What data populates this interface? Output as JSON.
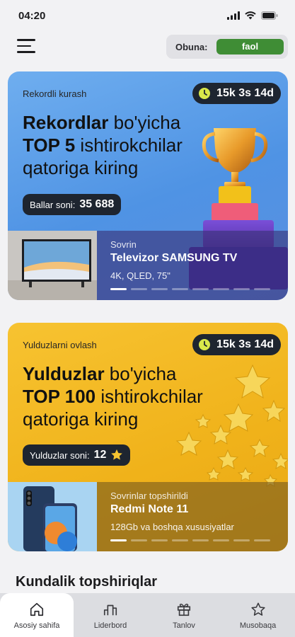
{
  "status_bar": {
    "time": "04:20"
  },
  "header": {
    "subscription_label": "Obuna:",
    "subscription_status": "faol"
  },
  "cards": [
    {
      "tag": "Rekordli kurash",
      "timer": "15k 3s 14d",
      "title_bold_1": "Rekordlar",
      "title_rest_1": " bo'yicha",
      "title_bold_2": "TOP 5",
      "title_rest_2": " ishtirokchilar",
      "title_line_3": "qatoriga kiring",
      "score_label": "Ballar soni:",
      "score_value": "35 688",
      "prize_kicker": "Sovrin",
      "prize_name": "Televizor SAMSUNG TV",
      "prize_spec": "4K, QLED, 75\"",
      "slides_total": 8,
      "slide_active": 1
    },
    {
      "tag": "Yulduzlarni ovlash",
      "timer": "15k 3s 14d",
      "title_bold_1": "Yulduzlar",
      "title_rest_1": " bo'yicha",
      "title_bold_2": "TOP 100",
      "title_rest_2": " ishtirokchilar",
      "title_line_3": "qatoriga kiring",
      "score_label": "Yulduzlar soni:",
      "score_value": "12",
      "prize_kicker": "Sovrinlar topshirildi",
      "prize_name": "Redmi Note 11",
      "prize_spec": "128Gb va boshqa xususiyatlar",
      "slides_total": 8,
      "slide_active": 1
    }
  ],
  "daily_tasks_title": "Kundalik topshiriqlar",
  "tabs": [
    {
      "label": "Asosiy sahifa",
      "icon": "home-icon",
      "active": true
    },
    {
      "label": "Liderbord",
      "icon": "leaderboard-icon",
      "active": false
    },
    {
      "label": "Tanlov",
      "icon": "gift-icon",
      "active": false
    },
    {
      "label": "Musobaqa",
      "icon": "star-outline-icon",
      "active": false
    }
  ],
  "colors": {
    "background": "#f2f2f4",
    "blue_card": "#5b9eea",
    "yellow_card": "#f2b625",
    "dark_chip": "#1e2530",
    "status_green": "#3f8d35",
    "timer_clock": "#d9e84a"
  }
}
